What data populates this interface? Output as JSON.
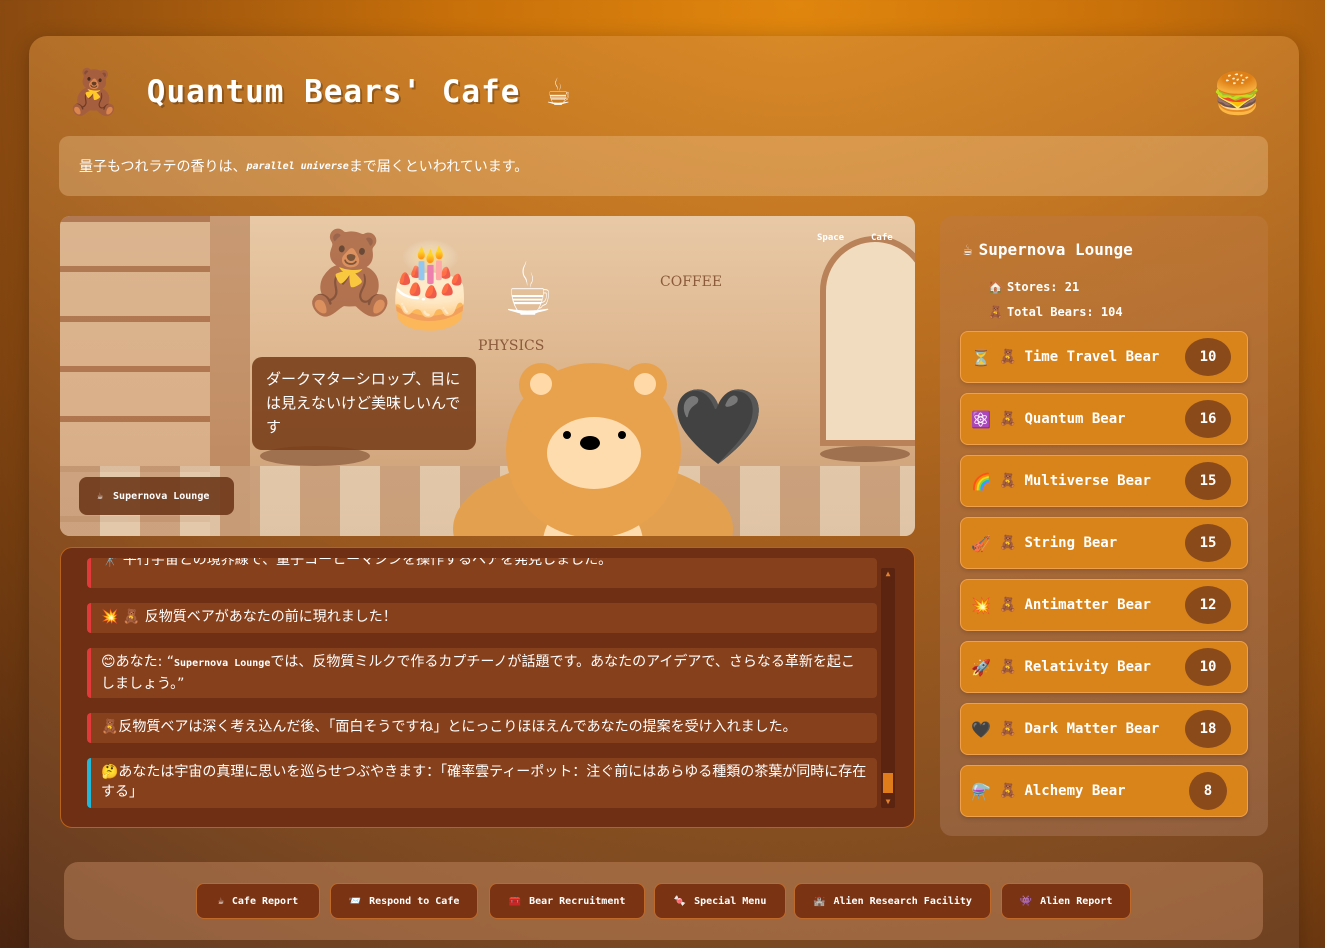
{
  "header": {
    "bear_icon": "🧸",
    "title": "Quantum Bears' Cafe",
    "cup_icon": "☕",
    "menu_icon": "🍔"
  },
  "quote": {
    "before": "量子もつれラテの香りは、",
    "emphasis": "parallel universe",
    "after": "まで届くといわれています。"
  },
  "scene": {
    "tab_space": "Space",
    "tab_cafe": "Cafe",
    "wall_text_physics": "PHYSICS",
    "wall_text_coffee": "COFFEE",
    "speech": "ダークマターシロップ、目には見えないけど美味しいんです",
    "location_icon": "☕",
    "location": "Supernova Lounge",
    "items": [
      "🎂",
      "☕",
      "🖤"
    ]
  },
  "log": {
    "messages": [
      {
        "text": "🔭 平行宇宙との境界線で、量子コーヒーマシンを操作するベアを発見しました。",
        "color": "red"
      },
      {
        "text": "💥 🧸 反物質ベアがあなたの前に現れました！",
        "color": "red"
      },
      {
        "prefix": "😊あなた: “",
        "place": "Supernova Lounge",
        "suffix": "では、反物質ミルクで作るカプチーノが話題です。あなたのアイデアで、さらなる革新を起こしましょう。”",
        "color": "red"
      },
      {
        "text": "🧸反物質ベアは深く考え込んだ後、「面白そうですね」とにっこりほほえんであなたの提案を受け入れました。",
        "color": "red"
      },
      {
        "text": "🤔あなたは宇宙の真理に思いを巡らせつぶやきます：「確率雲ティーポット：注ぐ前にはあらゆる種類の茶葉が同時に存在する」",
        "color": "cyan"
      }
    ]
  },
  "sidebar": {
    "title_icon": "☕",
    "title": "Supernova Lounge",
    "stores_icon": "🏠",
    "stores": "Stores: 21",
    "total_icon": "🧸",
    "total": "Total Bears: 104",
    "bears": [
      {
        "icon": "⏳",
        "name": "Time Travel Bear",
        "count": "10"
      },
      {
        "icon": "⚛️",
        "name": "Quantum Bear",
        "count": "16"
      },
      {
        "icon": "🌈",
        "name": "Multiverse Bear",
        "count": "15"
      },
      {
        "icon": "🎻",
        "name": "String Bear",
        "count": "15"
      },
      {
        "icon": "💥",
        "name": "Antimatter Bear",
        "count": "12"
      },
      {
        "icon": "🚀",
        "name": "Relativity Bear",
        "count": "10"
      },
      {
        "icon": "🖤",
        "name": "Dark Matter Bear",
        "count": "18"
      },
      {
        "icon": "⚗️",
        "name": "Alchemy Bear",
        "count": "8"
      }
    ]
  },
  "actions": [
    {
      "icon": "☕",
      "label": "Cafe Report"
    },
    {
      "icon": "📨",
      "label": "Respond to Cafe"
    },
    {
      "icon": "🧰",
      "label": "Bear Recruitment"
    },
    {
      "icon": "🍬",
      "label": "Special Menu"
    },
    {
      "icon": "🏰",
      "label": "Alien Research Facility"
    },
    {
      "icon": "👾",
      "label": "Alien Report"
    }
  ]
}
